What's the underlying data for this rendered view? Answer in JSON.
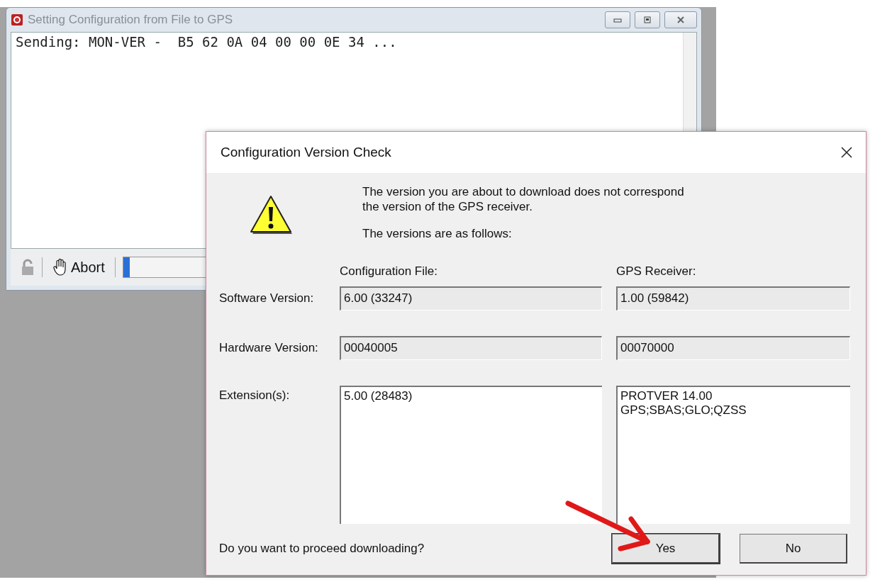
{
  "back_window": {
    "title": "Setting Configuration from File to GPS",
    "log_text": "Sending: MON-VER -  B5 62 0A 04 00 00 0E 34 ...",
    "toolbar": {
      "abort_label": "Abort",
      "progress": {
        "level": 0.03
      }
    }
  },
  "dialog": {
    "title": "Configuration Version Check",
    "message": "The version you are about to download does not correspond\nthe version of the GPS receiver.",
    "subtitle": "The versions are as follows:",
    "columns": [
      "Configuration File:",
      "GPS Receiver:"
    ],
    "rows": [
      {
        "label": "Software Version:",
        "kind": "line",
        "values": [
          "6.00 (33247)",
          "1.00 (59842)"
        ]
      },
      {
        "label": "Hardware Version:",
        "kind": "line",
        "values": [
          "00040005",
          "00070000"
        ]
      },
      {
        "label": "Extension(s):",
        "kind": "box",
        "values": [
          "5.00 (28483)",
          "PROTVER 14.00\nGPS;SBAS;GLO;QZSS"
        ]
      }
    ],
    "question": "Do you want to proceed downloading?",
    "buttons": [
      "Yes",
      "No"
    ]
  }
}
